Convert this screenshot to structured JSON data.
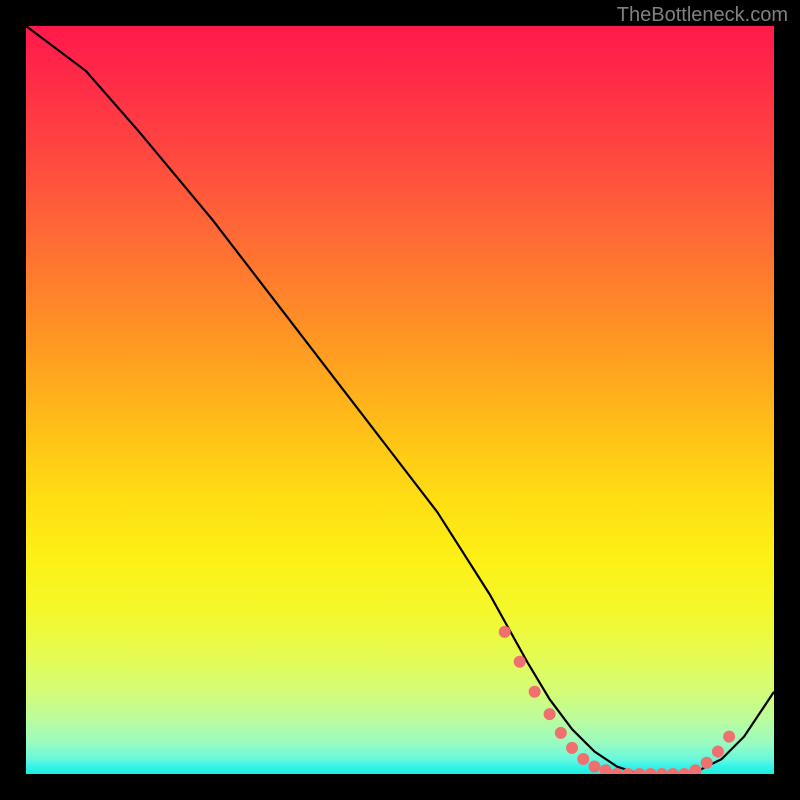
{
  "attribution": "TheBottleneck.com",
  "chart_data": {
    "type": "line",
    "title": "",
    "xlabel": "",
    "ylabel": "",
    "xlim": [
      0,
      100
    ],
    "ylim": [
      0,
      100
    ],
    "series": [
      {
        "name": "bottleneck-curve",
        "x": [
          0,
          8,
          15,
          25,
          35,
          45,
          55,
          62,
          67,
          70,
          73,
          76,
          79,
          82,
          85,
          88,
          90,
          93,
          96,
          100
        ],
        "y": [
          100,
          94,
          86,
          74,
          61,
          48,
          35,
          24,
          15,
          10,
          6,
          3,
          1,
          0,
          0,
          0,
          0.5,
          2,
          5,
          11
        ]
      }
    ],
    "markers": {
      "name": "highlight-dots",
      "color": "#f07070",
      "points": [
        {
          "x": 64,
          "y": 19
        },
        {
          "x": 66,
          "y": 15
        },
        {
          "x": 68,
          "y": 11
        },
        {
          "x": 70,
          "y": 8
        },
        {
          "x": 71.5,
          "y": 5.5
        },
        {
          "x": 73,
          "y": 3.5
        },
        {
          "x": 74.5,
          "y": 2
        },
        {
          "x": 76,
          "y": 1
        },
        {
          "x": 77.5,
          "y": 0.5
        },
        {
          "x": 79,
          "y": 0
        },
        {
          "x": 80.5,
          "y": 0
        },
        {
          "x": 82,
          "y": 0
        },
        {
          "x": 83.5,
          "y": 0
        },
        {
          "x": 85,
          "y": 0
        },
        {
          "x": 86.5,
          "y": 0
        },
        {
          "x": 88,
          "y": 0
        },
        {
          "x": 89.5,
          "y": 0.5
        },
        {
          "x": 91,
          "y": 1.5
        },
        {
          "x": 92.5,
          "y": 3
        },
        {
          "x": 94,
          "y": 5
        }
      ]
    },
    "gradient_stops": [
      {
        "pos": 0,
        "color": "#ff1a4a"
      },
      {
        "pos": 50,
        "color": "#ffc317"
      },
      {
        "pos": 100,
        "color": "#1ceeda"
      }
    ]
  }
}
